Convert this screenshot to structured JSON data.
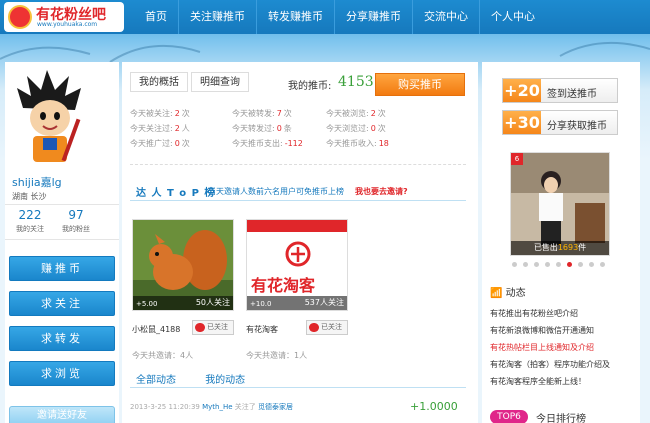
{
  "header": {
    "logo_text": "有花粉丝吧",
    "logo_url": "www.youhuaka.com",
    "nav": [
      "首页",
      "关注赚推币",
      "转发赚推币",
      "分享赚推币",
      "交流中心",
      "个人中心"
    ]
  },
  "profile": {
    "name": "shijia嘉lg",
    "location": "湖南  长沙",
    "following_count": "222",
    "following_label": "我的关注",
    "fans_count": "97",
    "fans_label": "我的粉丝"
  },
  "left_buttons": [
    "赚推币",
    "求关注",
    "求转发",
    "求浏览"
  ],
  "invite_label": "邀请送好友",
  "main": {
    "tab_overview": "我的概括",
    "tab_detail": "明细查询",
    "coin_label": "我的推币:",
    "coin_value": "4153",
    "buy_label": "购买推币",
    "stats": [
      [
        {
          "label": "今天被关注:",
          "value": "2",
          "unit": "次"
        },
        {
          "label": "今天被转发:",
          "value": "7",
          "unit": "次"
        },
        {
          "label": "今天被浏览:",
          "value": "2",
          "unit": "次"
        }
      ],
      [
        {
          "label": "今天关注过:",
          "value": "2",
          "unit": "人"
        },
        {
          "label": "今天转发过:",
          "value": "0",
          "unit": "条"
        },
        {
          "label": "今天浏览过:",
          "value": "0",
          "unit": "次"
        }
      ],
      [
        {
          "label": "今天推广过:",
          "value": "0",
          "unit": "次"
        },
        {
          "label": "今天推币支出:",
          "value": "-112",
          "unit": ""
        },
        {
          "label": "今天推币收入:",
          "value": "18",
          "unit": ""
        }
      ]
    ],
    "section_title": "达 人 T o P 榜",
    "section_sub": "当天邀请人数前六名用户可免推币上榜",
    "section_link": "我也要去邀请?",
    "cards": [
      {
        "coin": "+5.00",
        "followers": "50人关注",
        "name": "小松鼠_4188",
        "follow_btn": "已关注",
        "today": "今天共邀请：4人"
      },
      {
        "coin": "+10.0",
        "followers": "537人关注",
        "name": "有花淘客",
        "follow_btn": "已关注",
        "today": "今天共邀请：1人"
      }
    ],
    "card2_logo_text": "有花淘客",
    "feed_tab_all": "全部动态",
    "feed_tab_mine": "我的动态",
    "feed": {
      "time": "2013-3-25 11:20:39",
      "user": "Myth_He",
      "action": "关注了",
      "target": "觅德泰家居",
      "coin": "+1.0000"
    }
  },
  "right": {
    "sign_num": "+20",
    "sign_label": "签到送推币",
    "share_num": "+30",
    "share_label": "分享获取推币",
    "photo_badge": "6",
    "photo_caption_pre": "已售出",
    "photo_caption_num": "1693",
    "photo_caption_post": "件",
    "dynamics_title": "动态",
    "news": [
      "有花推出有花粉丝吧介绍",
      "有花新浪微博和微信开通通知",
      "有花热帖栏目上线通知及介绍",
      "有花淘客（拍客）程序功能介绍及",
      "有花淘客程序全能新上线！"
    ],
    "rank_badge": "TOP6",
    "rank_title": "今日排行榜"
  },
  "colors": {
    "brand_blue": "#1679bd",
    "accent_orange": "#f27a10",
    "coin_green": "#3aa03a",
    "alert_red": "#e0262a"
  }
}
